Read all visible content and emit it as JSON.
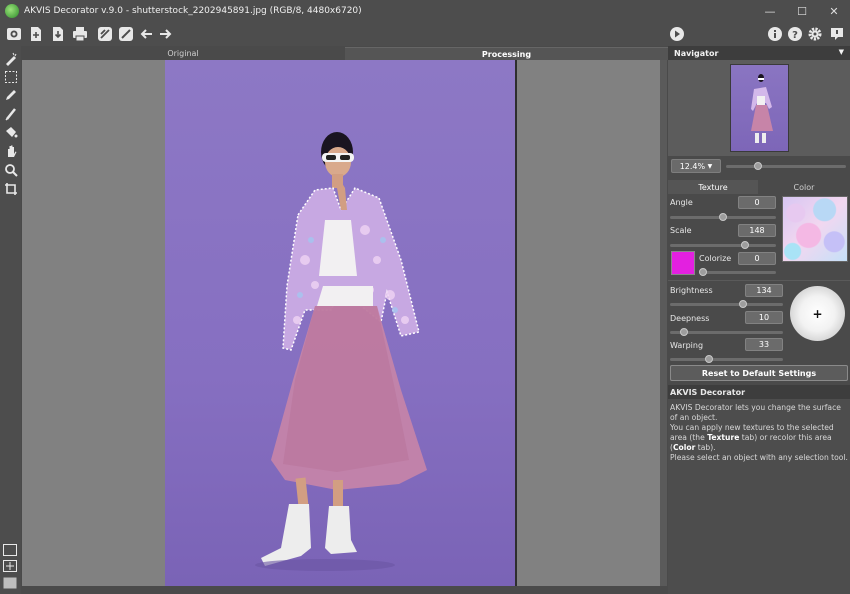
{
  "window": {
    "title": "AKVIS Decorator v.9.0 - shutterstock_2202945891.jpg (RGB/8, 4480x6720)",
    "minimize": "—",
    "maximize": "☐",
    "close": "✕"
  },
  "view_tabs": {
    "original": "Original",
    "processing": "Processing"
  },
  "navigator": {
    "title": "Navigator",
    "zoom": "12.4%",
    "zoom_slider": 0.12
  },
  "panel_tabs": {
    "texture": "Texture",
    "color": "Color"
  },
  "settings": {
    "angle_label": "Angle",
    "angle_value": "0",
    "scale_label": "Scale",
    "scale_value": "148",
    "colorize_label": "Colorize",
    "colorize_value": "0",
    "colorize_color": "#e320e0",
    "brightness_label": "Brightness",
    "brightness_value": "134",
    "deepness_label": "Deepness",
    "deepness_value": "10",
    "warping_label": "Warping",
    "warping_value": "33"
  },
  "reset_button": "Reset to Default Settings",
  "help": {
    "title": "AKVIS Decorator",
    "line1": "AKVIS Decorator lets you change the surface of an object.",
    "line2a": "You can apply new textures to the selected area (the ",
    "line2b": "Texture",
    "line2c": " tab) or recolor this area (",
    "line2d": "Color",
    "line2e": " tab).",
    "line3": "Please select an object with any selection tool."
  },
  "icons": {
    "toolbar": [
      "open-image-icon",
      "open-file-icon",
      "save-icon",
      "export-icon",
      "print-icon",
      "batch-icon",
      "share-icon",
      "undo-icon",
      "redo-icon",
      "run-icon",
      "info-icon",
      "help-icon",
      "settings-icon",
      "notifications-icon"
    ],
    "tools": [
      "magic-brush-icon",
      "rect-selection-icon",
      "pencil-icon",
      "eraser-icon",
      "bucket-icon",
      "hand-icon",
      "zoom-icon",
      "crop-icon"
    ]
  }
}
